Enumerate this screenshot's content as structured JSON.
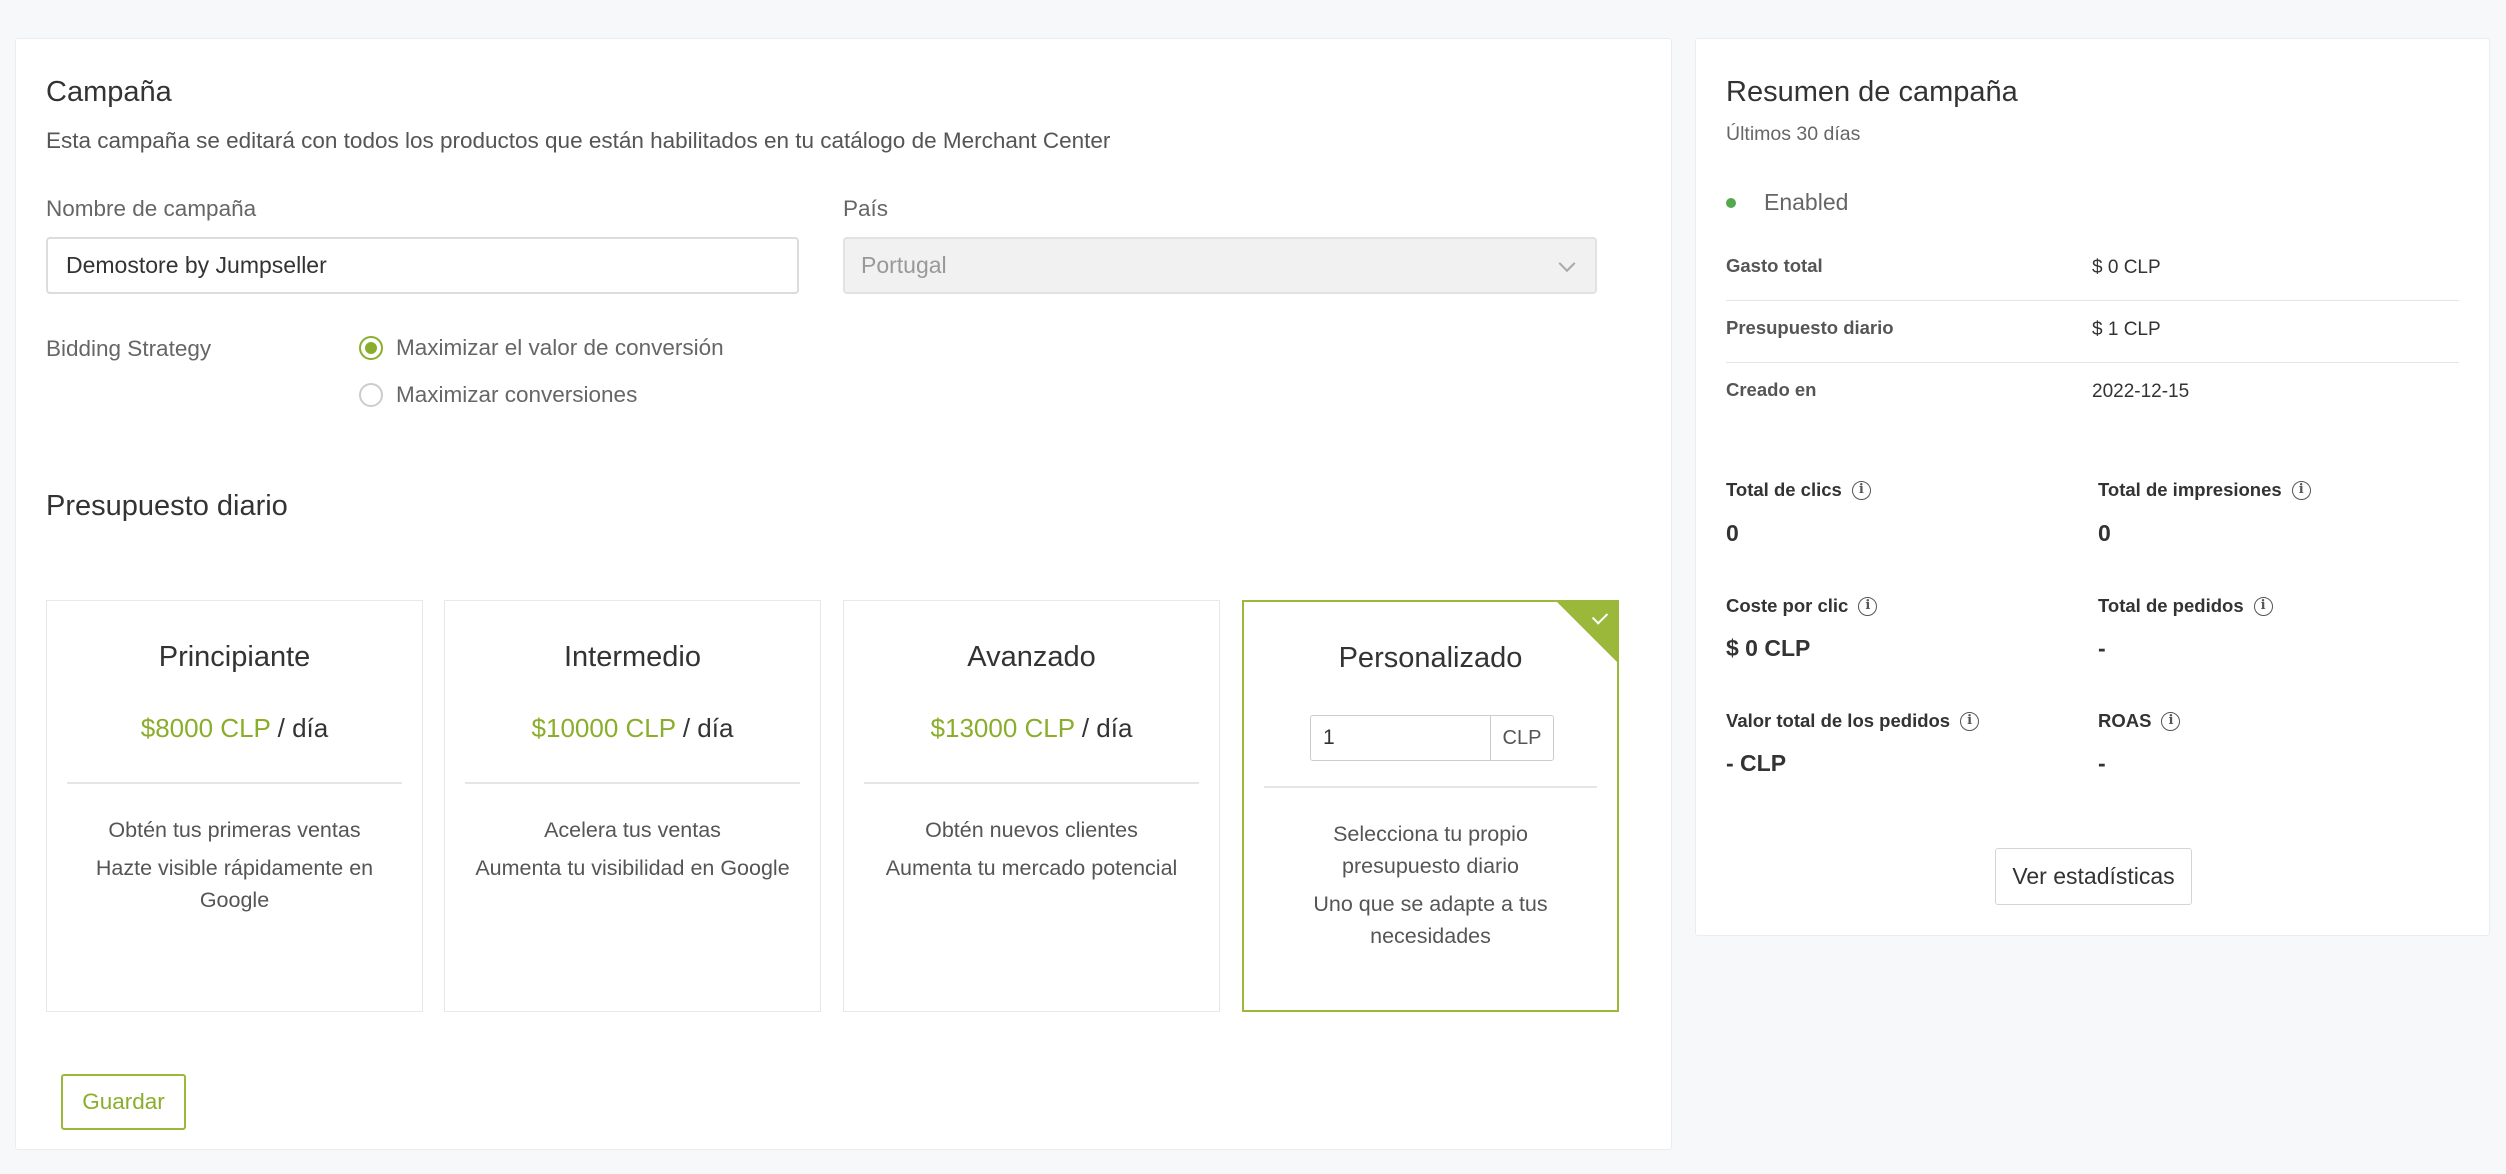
{
  "campaign": {
    "title": "Campaña",
    "description": "Esta campaña se editará con todos los productos que están habilitados en tu catálogo de Merchant Center",
    "name_label": "Nombre de campaña",
    "name_value": "Demostore by Jumpseller",
    "country_label": "País",
    "country_value": "Portugal",
    "bidding_label": "Bidding Strategy",
    "bidding_options": [
      {
        "label": "Maximizar el valor de conversión",
        "selected": true
      },
      {
        "label": "Maximizar conversiones",
        "selected": false
      }
    ]
  },
  "budget": {
    "title": "Presupuesto diario",
    "per_day": "/ día",
    "cards": [
      {
        "name": "Principiante",
        "price": "$8000 CLP",
        "lines": [
          "Obtén tus primeras ventas",
          "Hazte visible rápidamente en Google"
        ],
        "selected": false
      },
      {
        "name": "Intermedio",
        "price": "$10000 CLP",
        "lines": [
          "Acelera tus ventas",
          "Aumenta tu visibilidad en Google"
        ],
        "selected": false
      },
      {
        "name": "Avanzado",
        "price": "$13000 CLP",
        "lines": [
          "Obtén nuevos clientes",
          "Aumenta tu mercado potencial"
        ],
        "selected": false
      },
      {
        "name": "Personalizado",
        "custom_value": "1",
        "custom_unit": "CLP",
        "lines": [
          "Selecciona tu propio presupuesto diario",
          "Uno que se adapte a tus necesidades"
        ],
        "selected": true
      }
    ],
    "save_label": "Guardar"
  },
  "summary": {
    "title": "Resumen de campaña",
    "period": "Últimos 30 días",
    "status": "Enabled",
    "status_color": "#55a84b",
    "rows": [
      {
        "key": "Gasto total",
        "value": "$ 0 CLP"
      },
      {
        "key": "Presupuesto diario",
        "value": "$ 1 CLP"
      },
      {
        "key": "Creado en",
        "value": "2022-12-15"
      }
    ],
    "metrics": [
      {
        "label": "Total de clics",
        "value": "0"
      },
      {
        "label": "Total de impresiones",
        "value": "0"
      },
      {
        "label": "Coste por clic",
        "value": "$ 0 CLP"
      },
      {
        "label": "Total de pedidos",
        "value": "-"
      },
      {
        "label": "Valor total de los pedidos",
        "value": "- CLP"
      },
      {
        "label": "ROAS",
        "value": "-"
      }
    ],
    "stats_button": "Ver estadísticas"
  },
  "colors": {
    "accent": "#8aae2b",
    "selected_border": "#9bb83a"
  }
}
